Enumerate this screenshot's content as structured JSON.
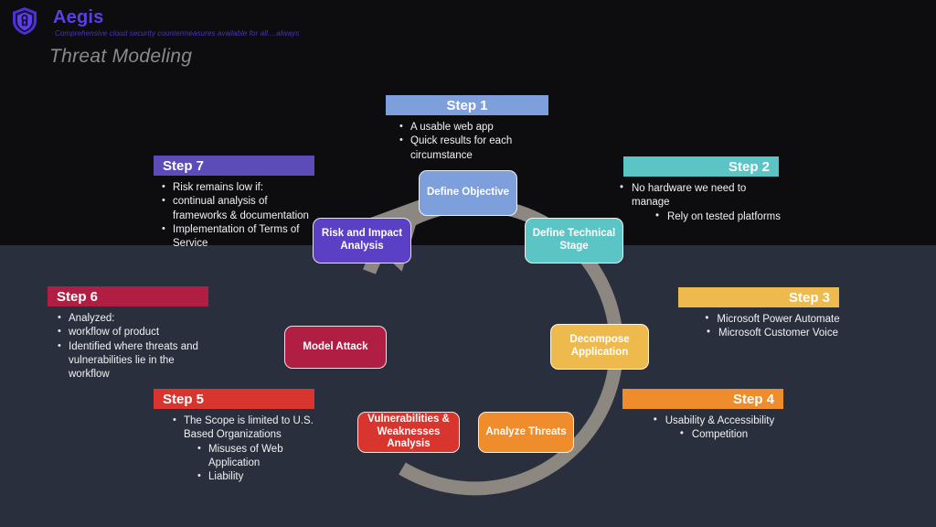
{
  "brand": {
    "name": "Aegis",
    "tagline": "Comprehensive cloud security countermeasures available for all....always",
    "logo_icon": "shield-lock-icon",
    "color": "#5b3fe8"
  },
  "page": {
    "title": "Threat Modeling",
    "background_top": "#0d0d0f",
    "background_bottom": "#2a2f3d"
  },
  "cycle": {
    "ring_color": "#8c8780",
    "direction": "clockwise",
    "nodes": [
      {
        "label": "Define Objective",
        "color": "#7da0dc",
        "text_color": "#ffffff"
      },
      {
        "label": "Define Technical Stage",
        "color": "#5bc4c4",
        "text_color": "#ffffff"
      },
      {
        "label": "Decompose Application",
        "color": "#eeba4d",
        "text_color": "#ffffff"
      },
      {
        "label": "Analyze Threats",
        "color": "#ef8c2b",
        "text_color": "#ffffff"
      },
      {
        "label": "Vulnerabilities & Weaknesses Analysis",
        "color": "#d8352f",
        "text_color": "#ffffff"
      },
      {
        "label": "Model Attack",
        "color": "#b01e44",
        "text_color": "#ffffff"
      },
      {
        "label": "Risk and Impact Analysis",
        "color": "#5b3fc4",
        "text_color": "#ffffff"
      }
    ]
  },
  "steps": [
    {
      "id": "step1",
      "title": "Step 1",
      "bar_color": "#7da0dc",
      "title_align": "center",
      "bullets": [
        {
          "text": "A usable web app",
          "level": 1
        },
        {
          "text": "Quick results for each circumstance",
          "level": 1
        }
      ]
    },
    {
      "id": "step2",
      "title": "Step 2",
      "bar_color": "#5bc4c4",
      "title_align": "right",
      "bullets": [
        {
          "text": "No hardware we need to manage",
          "level": 1
        },
        {
          "text": "Rely on tested platforms",
          "level": 1
        }
      ]
    },
    {
      "id": "step3",
      "title": "Step 3",
      "bar_color": "#eeba4d",
      "title_align": "right",
      "bullets": [
        {
          "text": "Microsoft Power Automate",
          "level": 1
        },
        {
          "text": "Microsoft Customer Voice",
          "level": 1
        }
      ]
    },
    {
      "id": "step4",
      "title": "Step 4",
      "bar_color": "#ef8c2b",
      "title_align": "right",
      "bullets": [
        {
          "text": "Usability & Accessibility",
          "level": 1
        },
        {
          "text": "Competition",
          "level": 1
        }
      ]
    },
    {
      "id": "step5",
      "title": "Step 5",
      "bar_color": "#d8352f",
      "title_align": "left",
      "bullets": [
        {
          "text": "The Scope is limited to U.S. Based Organizations",
          "level": 1
        },
        {
          "text": "Misuses of Web Application",
          "level": 2
        },
        {
          "text": "Liability",
          "level": 2
        }
      ]
    },
    {
      "id": "step6",
      "title": "Step 6",
      "bar_color": "#b01e44",
      "title_align": "left",
      "bullets": [
        {
          "text": "Analyzed:",
          "level": 1
        },
        {
          "text": "workflow of product",
          "level": 1
        },
        {
          "text": "Identified where threats and vulnerabilities lie in the workflow",
          "level": 1
        }
      ]
    },
    {
      "id": "step7",
      "title": "Step 7",
      "bar_color": "#5b4cb8",
      "title_align": "left",
      "bullets": [
        {
          "text": "Risk remains low if:",
          "level": 1
        },
        {
          "text": "continual analysis of frameworks & documentation",
          "level": 1
        },
        {
          "text": "Implementation of Terms of Service",
          "level": 1
        }
      ]
    }
  ]
}
